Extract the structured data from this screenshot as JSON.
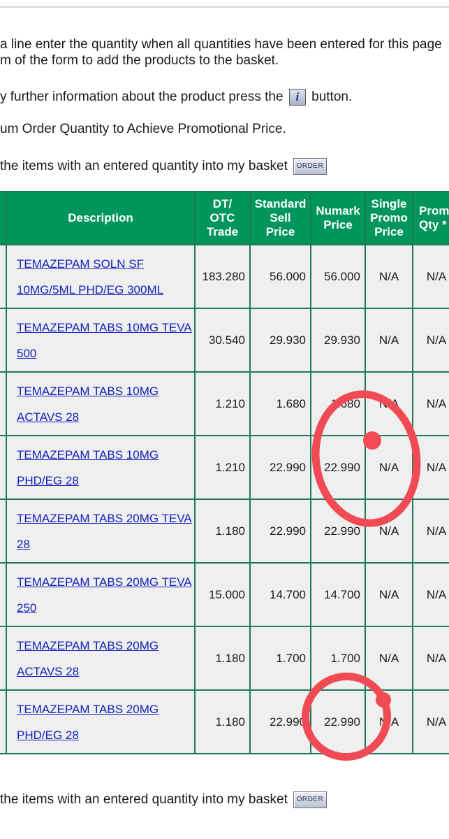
{
  "instructions": {
    "line1": "a line enter the quantity when all quantities have been entered for this page",
    "line2": "m of the form to add the products to the basket.",
    "line3_before": "y further information about the product press the",
    "line3_after": "button.",
    "line4": "um Order Quantity to Achieve Promotional Price.",
    "basket_text": "the items with an entered quantity into my basket",
    "order_label": "ORDER",
    "info_glyph": "i"
  },
  "table": {
    "headers": [
      "Description",
      "DT/ OTC Trade",
      "Standard Sell Price",
      "Numark Price",
      "Single Promo Price",
      "Promo Qty *"
    ],
    "header_lines": {
      "dt": [
        "DT/",
        "OTC",
        "Trade"
      ],
      "std": [
        "Standard",
        "Sell",
        "Price"
      ],
      "numark": [
        "Numark",
        "Price"
      ],
      "single": [
        "Single",
        "Promo",
        "Price"
      ],
      "promo": [
        "Promo",
        "Qty *"
      ]
    },
    "rows": [
      {
        "desc1": "TEMAZEPAM SOLN SF",
        "desc2": "10MG/5ML PHD/EG 300ML",
        "trade": "183.280",
        "sell": "56.000",
        "numark": "56.000",
        "promo": "N/A",
        "qty": "N/A"
      },
      {
        "desc1": "TEMAZEPAM TABS 10MG TEVA",
        "desc2": "500",
        "trade": "30.540",
        "sell": "29.930",
        "numark": "29.930",
        "promo": "N/A",
        "qty": "N/A"
      },
      {
        "desc1": "TEMAZEPAM TABS 10MG",
        "desc2": "ACTAVS 28",
        "trade": "1.210",
        "sell": "1.680",
        "numark": "1.680",
        "promo": "N/A",
        "qty": "N/A"
      },
      {
        "desc1": "TEMAZEPAM TABS 10MG",
        "desc2": "PHD/EG 28",
        "trade": "1.210",
        "sell": "22.990",
        "numark": "22.990",
        "promo": "N/A",
        "qty": "N/A"
      },
      {
        "desc1": "TEMAZEPAM TABS 20MG TEVA",
        "desc2": "28",
        "trade": "1.180",
        "sell": "22.990",
        "numark": "22.990",
        "promo": "N/A",
        "qty": "N/A"
      },
      {
        "desc1": "TEMAZEPAM TABS 20MG TEVA",
        "desc2": "250",
        "trade": "15.000",
        "sell": "14.700",
        "numark": "14.700",
        "promo": "N/A",
        "qty": "N/A"
      },
      {
        "desc1": "TEMAZEPAM TABS 20MG",
        "desc2": "ACTAVS 28",
        "trade": "1.180",
        "sell": "1.700",
        "numark": "1.700",
        "promo": "N/A",
        "qty": "N/A"
      },
      {
        "desc1": "TEMAZEPAM TABS 20MG",
        "desc2": "PHD/EG 28",
        "trade": "1.180",
        "sell": "22.990",
        "numark": "22.990",
        "promo": "N/A",
        "qty": "N/A"
      }
    ]
  },
  "colors": {
    "header_bg": "#00955a",
    "border": "#1e7a54",
    "link": "#1122bb",
    "annotation": "#f04b55"
  }
}
